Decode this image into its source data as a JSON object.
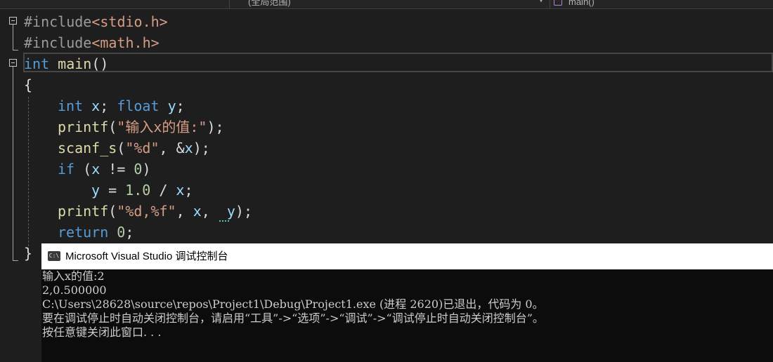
{
  "navbar": {
    "scope": "(全局范围)",
    "function": "main()"
  },
  "code": {
    "line1": {
      "directive": "#include",
      "file": "<stdio.h>"
    },
    "line2": {
      "directive": "#include",
      "file": "<math.h>"
    },
    "line3": {
      "type": "int",
      "name": "main",
      "parens": "()"
    },
    "line4": {
      "brace": "{"
    },
    "line5": {
      "kw1": "int",
      "v1": "x",
      "sep1": "; ",
      "kw2": "float",
      "v2": "y",
      "end": ";"
    },
    "line6": {
      "fn": "printf",
      "open": "(",
      "str": "\"输入x的值:\"",
      "close": ");"
    },
    "line7": {
      "fn": "scanf_s",
      "open": "(",
      "str": "\"%d\"",
      "mid": ", &",
      "var": "x",
      "close": ");"
    },
    "line8": {
      "kw": "if",
      "open": " (",
      "var": "x",
      "op": " != ",
      "num": "0",
      "close": ")"
    },
    "line9": {
      "var1": "y",
      "op1": " = ",
      "num": "1.0",
      "op2": " / ",
      "var2": "x",
      "end": ";"
    },
    "line10": {
      "fn": "printf",
      "open": "(",
      "str": "\"%d,%f\"",
      "c1": ", ",
      "v1": "x",
      "c2": ",  ",
      "v2": "y",
      "close": ");"
    },
    "line11": {
      "kw": "return",
      "sp": " ",
      "num": "0",
      "end": ";"
    },
    "line12": {
      "brace": "}"
    }
  },
  "console": {
    "title": "Microsoft Visual Studio 调试控制台",
    "icon_text": "C:\\",
    "lines": [
      "输入x的值:2",
      "2,0.500000",
      "C:\\Users\\28628\\source\\repos\\Project1\\Debug\\Project1.exe (进程 2620)已退出，代码为 0。",
      "要在调试停止时自动关闭控制台，请启用“工具”->“选项”->“调试”->“调试停止时自动关闭控制台”。",
      "按任意键关闭此窗口. . ."
    ]
  },
  "colors": {
    "background": "#1e1e1e",
    "keyword": "#569cd6",
    "function": "#dcdcaa",
    "string": "#d69d85",
    "variable": "#9cdcfe",
    "number": "#b5cea8",
    "console_bg": "#0c0c0c"
  }
}
